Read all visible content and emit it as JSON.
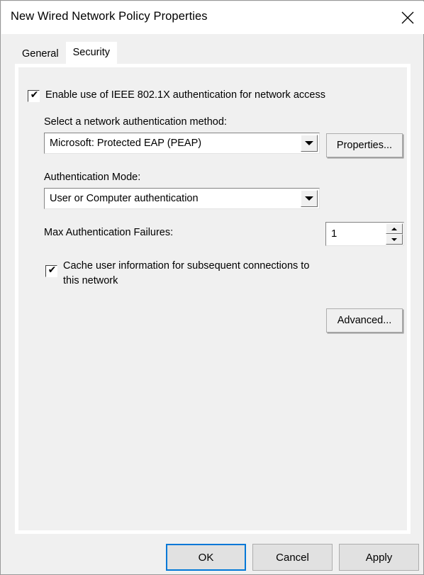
{
  "window": {
    "title": "New Wired Network Policy Properties",
    "close_icon": "close-icon"
  },
  "tabs": [
    {
      "label": "General",
      "selected": false
    },
    {
      "label": "Security",
      "selected": true
    }
  ],
  "security_tab": {
    "enable_8021x": {
      "label": "Enable use of IEEE 802.1X authentication for network access",
      "checked": true,
      "check_glyph": "✔"
    },
    "auth_method": {
      "label": "Select a network authentication method:",
      "value": "Microsoft: Protected EAP (PEAP)",
      "properties_button": "Properties..."
    },
    "auth_mode": {
      "label": "Authentication Mode:",
      "value": "User or Computer authentication"
    },
    "max_failures": {
      "label": "Max Authentication Failures:",
      "value": "1"
    },
    "cache_user_info": {
      "label_line1": "Cache user information for subsequent connections to",
      "label_line2": "this network",
      "checked": true,
      "check_glyph": "✔"
    },
    "advanced_button": "Advanced..."
  },
  "footer": {
    "ok": "OK",
    "cancel": "Cancel",
    "apply": "Apply"
  },
  "colors": {
    "accent": "#0078d7",
    "dialog_bg": "#f0f0f0",
    "panel_bg": "#ffffff",
    "button_bg": "#e1e1e1"
  }
}
